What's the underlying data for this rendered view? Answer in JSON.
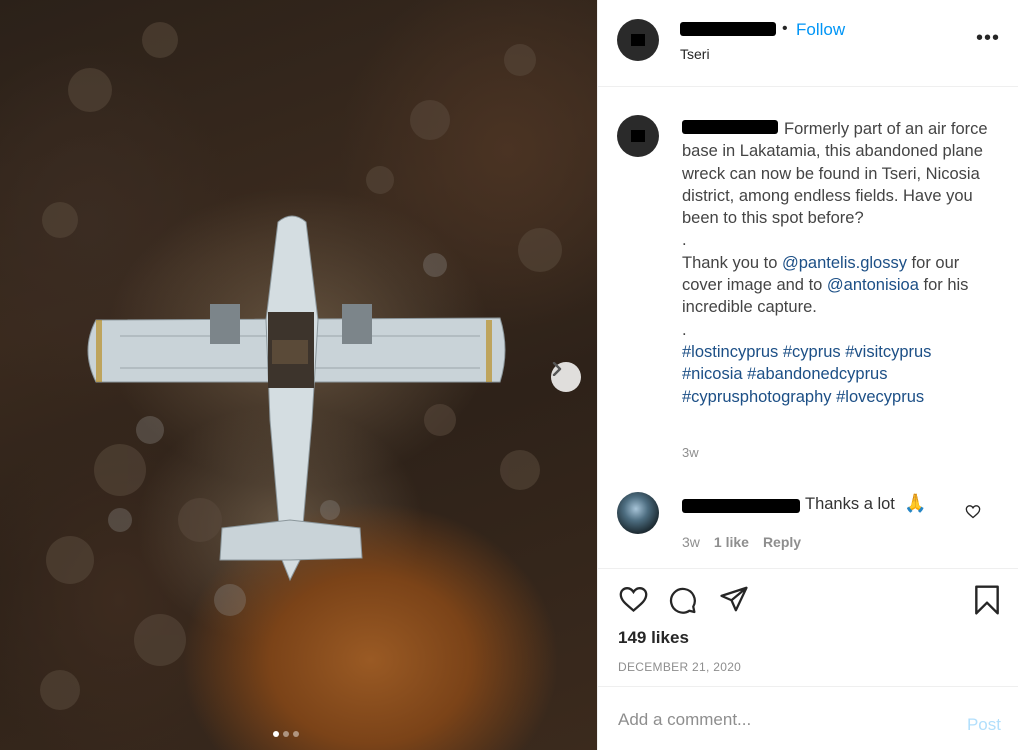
{
  "photo": {
    "alt": "",
    "carousel_dots": 3,
    "active_dot": 0
  },
  "header": {
    "follow_separator": "•",
    "follow_label": "Follow",
    "location": "Tseri",
    "more_label": "•••"
  },
  "caption": {
    "text_line1": "Formerly part of an air force base in Lakatamia, this abandoned plane wreck can now be found in Tseri, Nicosia district, among endless fields. Have you been to this spot before?",
    "sep1": ".",
    "thanks_prefix": "Thank you to ",
    "mention1": "@pantelis.glossy",
    "thanks_middle": " for our cover image and to ",
    "mention2": "@antonisioa",
    "thanks_suffix": " for his incredible capture.",
    "sep2": ".",
    "hashtags": "#lostincyprus #cyprus #visitcyprus #nicosia #abandonedcyprus #cyprusphotography #lovecyprus",
    "time": "3w"
  },
  "comment": {
    "text": "Thanks a lot",
    "emoji": "🙏",
    "time": "3w",
    "likes": "1 like",
    "reply_label": "Reply"
  },
  "actions": {
    "likes": "149 likes",
    "date": "DECEMBER 21, 2020"
  },
  "add_comment": {
    "placeholder": "Add a comment...",
    "post_label": "Post"
  },
  "colors": {
    "follow": "#0095f6",
    "link": "#1c4f86",
    "muted": "#8e8e8e",
    "post_disabled": "#b2dffc"
  }
}
